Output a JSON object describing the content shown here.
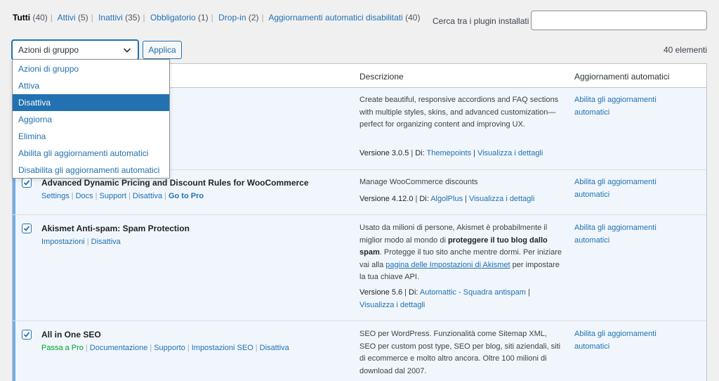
{
  "filters": [
    {
      "label": "Tutti",
      "count": "(40)",
      "current": true
    },
    {
      "label": "Attivi",
      "count": "(5)"
    },
    {
      "label": "Inattivi",
      "count": "(35)"
    },
    {
      "label": "Obbligatorio",
      "count": "(1)"
    },
    {
      "label": "Drop-in",
      "count": "(2)"
    },
    {
      "label": "Aggiornamenti automatici disabilitati",
      "count": "(40)"
    }
  ],
  "search": {
    "label": "Cerca tra i plugin installati",
    "value": ""
  },
  "bulk": {
    "selected": "Azioni di gruppo",
    "apply_label": "Applica",
    "options": [
      "Azioni di gruppo",
      "Attiva",
      "Disattiva",
      "Aggiorna",
      "Elimina",
      "Abilita gli aggiornamenti automatici",
      "Disabilita gli aggiornamenti automatici"
    ],
    "highlighted_index": 2
  },
  "item_count": "40 elementi",
  "table": {
    "headers": {
      "description": "Descrizione",
      "auto_updates": "Aggiornamenti automatici"
    },
    "rows": [
      {
        "name": "",
        "actions": [],
        "description": "Create beautiful, responsive accordions and FAQ sections with multiple styles, skins, and advanced customization—perfect for organizing content and improving UX.",
        "version": "Versione 3.0.5",
        "by_label": "Di:",
        "author": "Themepoints",
        "details": "Visualizza i dettagli",
        "auto_update": "Abilita gli aggiornamenti automatici"
      },
      {
        "name": "Advanced Dynamic Pricing and Discount Rules for WooCommerce",
        "actions": [
          "Settings",
          "Docs",
          "Support",
          "Disattiva",
          "Go to Pro"
        ],
        "description": "Manage WooCommerce discounts",
        "version": "Versione 4.12.0",
        "by_label": "Di:",
        "author": "AlgolPlus",
        "details": "Visualizza i dettagli",
        "auto_update": "Abilita gli aggiornamenti automatici"
      },
      {
        "name": "Akismet Anti-spam: Spam Protection",
        "actions": [
          "Impostazioni",
          "Disattiva"
        ],
        "description_parts": {
          "p1": "Usato da milioni di persone, Akismet è probabilmente il miglior modo al mondo di ",
          "bold": "proteggere il tuo blog dallo spam",
          "p2": ". Protegge il tuo sito anche mentre dormi. Per iniziare vai alla ",
          "link": "pagina delle Impostazioni di Akismet",
          "p3": " per impostare la tua chiave API."
        },
        "version": "Versione 5.6",
        "by_label": "Di:",
        "author": "Automattic - Squadra antispam",
        "details": "Visualizza i dettagli",
        "auto_update": "Abilita gli aggiornamenti automatici"
      },
      {
        "name": "All in One SEO",
        "actions": [
          "Passa a Pro",
          "Documentazione",
          "Supporto",
          "Impostazioni SEO",
          "Disattiva"
        ],
        "description": "SEO per WordPress. Funzionalità come Sitemap XML, SEO per custom post type, SEO per blog, siti aziendali, siti di ecommerce e molto altro ancora. Oltre 100 milioni di download dal 2007.",
        "auto_update": "Abilita gli aggiornamenti automatici"
      }
    ]
  }
}
